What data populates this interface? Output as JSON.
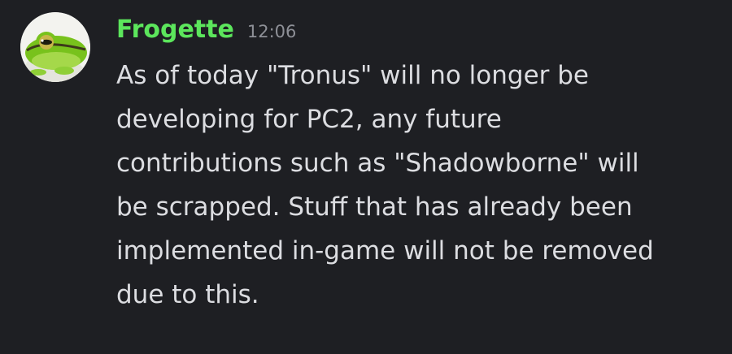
{
  "message": {
    "author": {
      "name": "Frogette",
      "name_color": "#5ce65c",
      "avatar": "frog-avatar"
    },
    "timestamp": "12:06",
    "content_lines": [
      "As of today \"Tronus\" will no longer be",
      "developing for PC2, any future",
      "contributions such as \"Shadowborne\" will",
      "be scrapped. Stuff that has already been",
      "implemented in-game will not be removed",
      "due to this."
    ]
  },
  "colors": {
    "background": "#1e1f23",
    "text": "#dcdde1",
    "timestamp": "#8e9097"
  }
}
